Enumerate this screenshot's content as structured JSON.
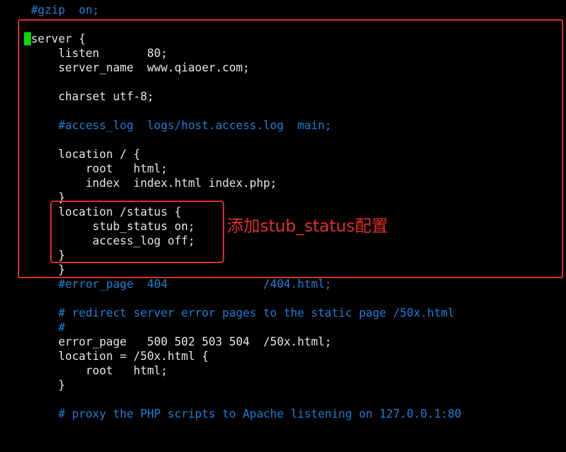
{
  "editor": {
    "lines": [
      "#gzip  on;",
      "",
      "server {",
      "    listen       80;",
      "    server_name  www.qiaoer.com;",
      "",
      "    charset utf-8;",
      "",
      "    #access_log  logs/host.access.log  main;",
      "",
      "    location / {",
      "        root   html;",
      "        index  index.html index.php;",
      "    }",
      "    location /status {",
      "         stub_status on;",
      "         access_log off;",
      "    }",
      "    }",
      "    #error_page  404              /404.html;",
      "",
      "    # redirect server error pages to the static page /50x.html",
      "    #",
      "    error_page   500 502 503 504  /50x.html;",
      "    location = /50x.html {",
      "        root   html;",
      "    }",
      "",
      "    # proxy the PHP scripts to Apache listening on 127.0.0.1:80"
    ]
  },
  "annotation": {
    "text": "添加stub_status配置"
  },
  "colors": {
    "background": "#000000",
    "text": "#e6e6e6",
    "comment": "#1e7fd6",
    "cursor": "#00e000",
    "highlight_box": "#e52d2d"
  }
}
